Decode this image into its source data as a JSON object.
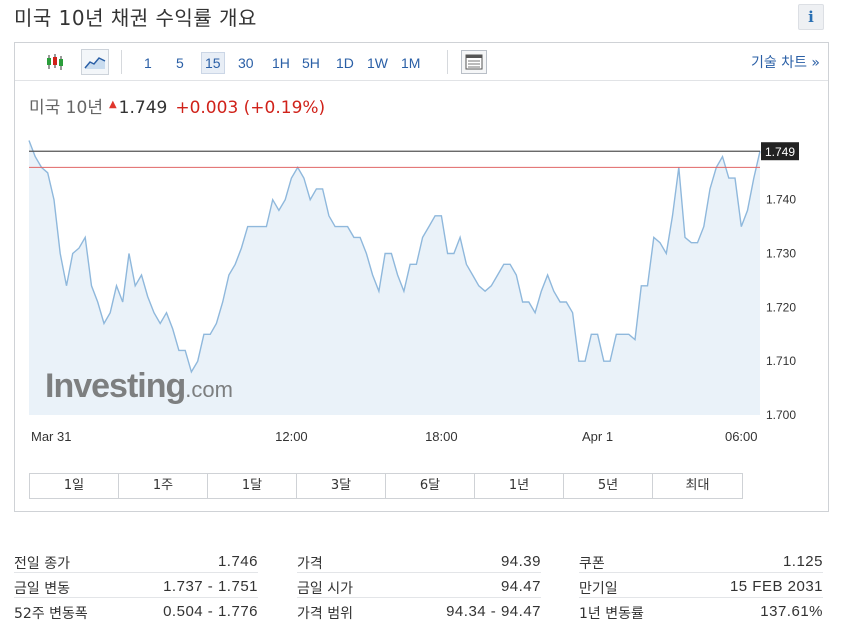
{
  "page": {
    "title": "미국 10년 채권 수익률 개요",
    "info_label": "i"
  },
  "toolbar": {
    "icons": [
      "candlestick-icon",
      "area-chart-icon",
      "table-icon"
    ],
    "intervals": [
      {
        "label": "1",
        "active": false
      },
      {
        "label": "5",
        "active": false
      },
      {
        "label": "15",
        "active": true
      },
      {
        "label": "30",
        "active": false
      },
      {
        "label": "1H",
        "active": false
      },
      {
        "label": "5H",
        "active": false
      },
      {
        "label": "1D",
        "active": false
      },
      {
        "label": "1W",
        "active": false
      },
      {
        "label": "1M",
        "active": false
      }
    ],
    "tech_chart_label": "기술 차트 »"
  },
  "quote": {
    "name": "미국 10년",
    "arrow": "▲",
    "price": "1.749",
    "change": "+0.003 (+0.19%)",
    "down_color": "#d0221a"
  },
  "chart_data": {
    "type": "area",
    "watermark": "Investing.com",
    "y_ticks": [
      "1.740",
      "1.730",
      "1.720",
      "1.710",
      "1.700"
    ],
    "ylim": [
      1.7,
      1.7535
    ],
    "x_ticks": [
      "Mar 31",
      "12:00",
      "18:00",
      "Apr 1",
      "06:00"
    ],
    "current_value": 1.749,
    "current_label": "1.749",
    "reference_value": 1.746,
    "series": [
      {
        "values": [
          1.751,
          1.748,
          1.746,
          1.745,
          1.74,
          1.73,
          1.724,
          1.73,
          1.731,
          1.733,
          1.724,
          1.721,
          1.717,
          1.719,
          1.724,
          1.721,
          1.73,
          1.724,
          1.726,
          1.722,
          1.719,
          1.717,
          1.719,
          1.716,
          1.712,
          1.712,
          1.708,
          1.71,
          1.715,
          1.715,
          1.717,
          1.721,
          1.726,
          1.728,
          1.731,
          1.735,
          1.735,
          1.735,
          1.735,
          1.74,
          1.738,
          1.74,
          1.744,
          1.746,
          1.744,
          1.74,
          1.742,
          1.742,
          1.737,
          1.735,
          1.735,
          1.735,
          1.733,
          1.733,
          1.73,
          1.726,
          1.723,
          1.73,
          1.73,
          1.726,
          1.723,
          1.728,
          1.728,
          1.733,
          1.735,
          1.737,
          1.737,
          1.73,
          1.73,
          1.733,
          1.728,
          1.726,
          1.724,
          1.723,
          1.724,
          1.726,
          1.728,
          1.728,
          1.726,
          1.721,
          1.721,
          1.719,
          1.723,
          1.726,
          1.723,
          1.721,
          1.721,
          1.719,
          1.71,
          1.71,
          1.715,
          1.715,
          1.71,
          1.71,
          1.715,
          1.715,
          1.715,
          1.714,
          1.724,
          1.724,
          1.733,
          1.732,
          1.73,
          1.737,
          1.746,
          1.733,
          1.732,
          1.732,
          1.735,
          1.742,
          1.746,
          1.748,
          1.744,
          1.744,
          1.735,
          1.738,
          1.744,
          1.749
        ]
      }
    ],
    "line_color": "#8fb8dc",
    "fill_color": "#eaf2f9"
  },
  "range_buttons": [
    "1일",
    "1주",
    "1달",
    "3달",
    "6달",
    "1년",
    "5년",
    "최대"
  ],
  "stats": [
    [
      {
        "label": "전일 종가",
        "value": "1.746"
      },
      {
        "label": "금일 변동",
        "value": "1.737 - 1.751"
      },
      {
        "label": "52주 변동폭",
        "value": "0.504 - 1.776"
      }
    ],
    [
      {
        "label": "가격",
        "value": "94.39"
      },
      {
        "label": "금일 시가",
        "value": "94.47"
      },
      {
        "label": "가격 범위",
        "value": "94.34 - 94.47"
      }
    ],
    [
      {
        "label": "쿠폰",
        "value": "1.125"
      },
      {
        "label": "만기일",
        "value": "15 FEB 2031"
      },
      {
        "label": "1년 변동률",
        "value": "137.61%"
      }
    ]
  ]
}
